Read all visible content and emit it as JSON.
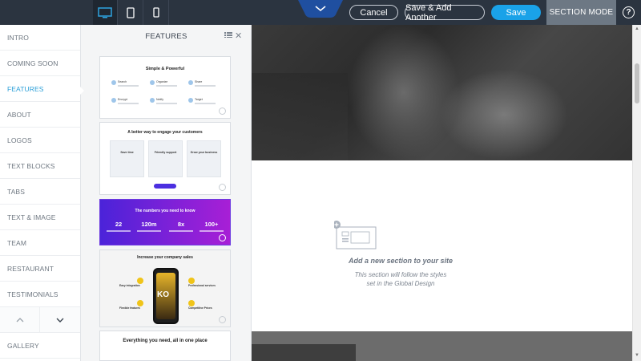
{
  "topbar": {
    "devices": {
      "desktop_icon": "desktop-icon",
      "tablet_icon": "tablet-icon",
      "phone_icon": "phone-icon"
    },
    "cancel_label": "Cancel",
    "save_add_label": "Save & Add Another",
    "save_label": "Save",
    "section_mode_label": "SECTION MODE",
    "help_label": "?",
    "colors": {
      "bar": "#2b3440",
      "save": "#1aa2e8",
      "section_mode": "#6d7884"
    }
  },
  "categories": {
    "items": [
      {
        "label": "INTRO"
      },
      {
        "label": "COMING SOON"
      },
      {
        "label": "FEATURES",
        "active": true
      },
      {
        "label": "ABOUT"
      },
      {
        "label": "LOGOS"
      },
      {
        "label": "TEXT BLOCKS"
      },
      {
        "label": "TABS"
      },
      {
        "label": "TEXT & IMAGE"
      },
      {
        "label": "TEAM"
      },
      {
        "label": "RESTAURANT"
      },
      {
        "label": "TESTIMONIALS"
      },
      {
        "label": "GALLERY"
      }
    ],
    "active_color": "#2a9fd8"
  },
  "panel": {
    "title": "FEATURES",
    "thumbnails": [
      {
        "heading": "Simple & Powerful",
        "items": [
          "Search",
          "Organize",
          "Share",
          "Encrypt",
          "Notify",
          "Target"
        ]
      },
      {
        "heading": "A better way to engage your customers",
        "cards": [
          "Save time",
          "Friendly support",
          "Grow your business"
        ]
      },
      {
        "heading": "The numbers you need to know",
        "stats": [
          "22",
          "120m",
          "8x",
          "100+"
        ]
      },
      {
        "heading": "Increase your company sales",
        "phone_text": "KO",
        "left_items": [
          "Easy integration",
          "Flexible features"
        ],
        "right_items": [
          "Professional services",
          "Competitive Prices"
        ]
      },
      {
        "heading": "Everything you need, all in one place"
      }
    ]
  },
  "canvas": {
    "add_title": "Add a new section to your site",
    "add_sub_line1": "This section will follow the styles",
    "add_sub_line2": "set in the Global Design"
  }
}
